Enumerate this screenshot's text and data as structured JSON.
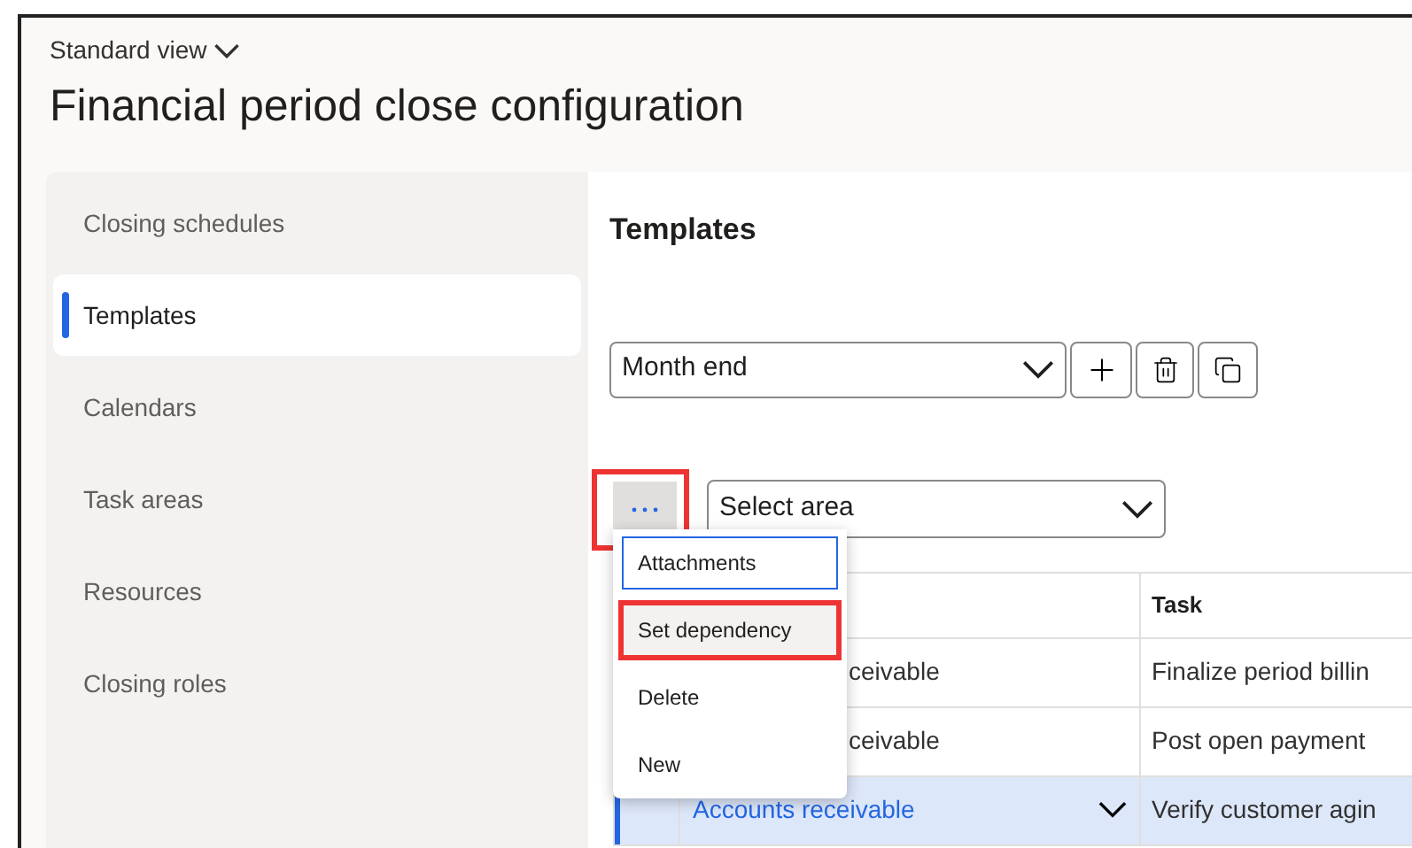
{
  "view_selector": {
    "label": "Standard view"
  },
  "page_title": "Financial period close configuration",
  "sidebar": {
    "items": [
      {
        "label": "Closing schedules",
        "selected": false
      },
      {
        "label": "Templates",
        "selected": true
      },
      {
        "label": "Calendars",
        "selected": false
      },
      {
        "label": "Task areas",
        "selected": false
      },
      {
        "label": "Resources",
        "selected": false
      },
      {
        "label": "Closing roles",
        "selected": false
      }
    ]
  },
  "content": {
    "title": "Templates",
    "template_select": {
      "value": "Month end"
    },
    "area_select": {
      "placeholder": "Select area"
    },
    "more_button": {
      "highlighted": true
    },
    "menu": {
      "items": [
        {
          "label": "Attachments",
          "focused": true,
          "selected": false,
          "highlighted": false
        },
        {
          "label": "Set dependency",
          "focused": false,
          "selected": true,
          "highlighted": true
        },
        {
          "label": "Delete",
          "focused": false,
          "selected": false,
          "highlighted": false
        },
        {
          "label": "New",
          "focused": false,
          "selected": false,
          "highlighted": false
        }
      ]
    },
    "table": {
      "columns": [
        "Task"
      ],
      "rows": [
        {
          "area": "ceivable",
          "task": "Finalize period billin",
          "selected": false
        },
        {
          "area": "ceivable",
          "task": "Post open payment",
          "selected": false
        },
        {
          "area": "Accounts receivable",
          "task": "Verify customer agin",
          "selected": true
        }
      ]
    }
  }
}
